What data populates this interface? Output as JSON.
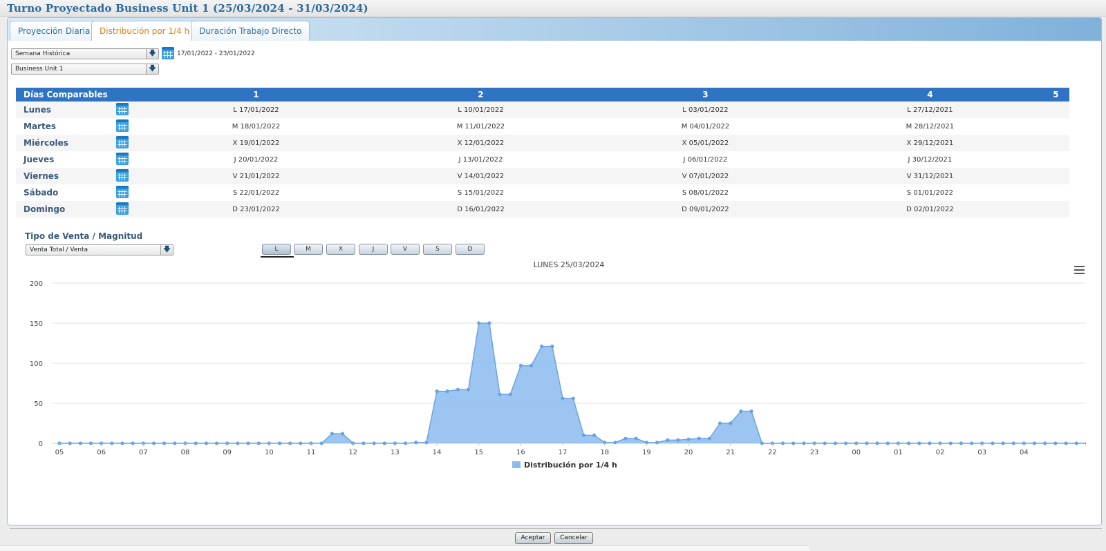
{
  "window": {
    "title": "Turno Proyectado Business Unit 1 (25/03/2024 - 31/03/2024)"
  },
  "tabs": [
    {
      "label": "Proyección Diaria",
      "active": false
    },
    {
      "label": "Distribución por 1/4 h",
      "active": true
    },
    {
      "label": "Duración Trabajo Directo",
      "active": false
    }
  ],
  "filters": {
    "week_select": "Semana Histórica",
    "week_range": "17/01/2022 - 23/01/2022",
    "unit_select": "Business Unit 1"
  },
  "comparable": {
    "header": "Días Comparables",
    "columns": [
      "1",
      "2",
      "3",
      "4",
      "5"
    ],
    "rows": [
      {
        "day": "Lunes",
        "dates": [
          "L 17/01/2022",
          "L 10/01/2022",
          "L 03/01/2022",
          "L 27/12/2021",
          ""
        ]
      },
      {
        "day": "Martes",
        "dates": [
          "M 18/01/2022",
          "M 11/01/2022",
          "M 04/01/2022",
          "M 28/12/2021",
          ""
        ]
      },
      {
        "day": "Miércoles",
        "dates": [
          "X 19/01/2022",
          "X 12/01/2022",
          "X 05/01/2022",
          "X 29/12/2021",
          ""
        ]
      },
      {
        "day": "Jueves",
        "dates": [
          "J 20/01/2022",
          "J 13/01/2022",
          "J 06/01/2022",
          "J 30/12/2021",
          ""
        ]
      },
      {
        "day": "Viernes",
        "dates": [
          "V 21/01/2022",
          "V 14/01/2022",
          "V 07/01/2022",
          "V 31/12/2021",
          ""
        ]
      },
      {
        "day": "Sábado",
        "dates": [
          "S 22/01/2022",
          "S 15/01/2022",
          "S 08/01/2022",
          "S 01/01/2022",
          ""
        ]
      },
      {
        "day": "Domingo",
        "dates": [
          "D 23/01/2022",
          "D 16/01/2022",
          "D 09/01/2022",
          "D 02/01/2022",
          ""
        ]
      }
    ]
  },
  "sales_type": {
    "label": "Tipo de Venta / Magnitud",
    "value": "Venta Total / Venta"
  },
  "day_buttons": [
    "L",
    "M",
    "X",
    "J",
    "V",
    "S",
    "D"
  ],
  "selected_day": "L",
  "actions": {
    "accept": "Aceptar",
    "cancel": "Cancelar"
  },
  "icons": {
    "calendar": "calendar-icon",
    "dropdown": "arrow-down-icon",
    "menu": "hamburger-menu-icon"
  },
  "colors": {
    "tab_active": "#e07b10",
    "table_header": "#2f74c2",
    "series_fill": "#8bbcee",
    "series_line": "#6aa3e0"
  },
  "chart_data": {
    "type": "area",
    "title": "LUNES 25/03/2024",
    "xlabel": "",
    "ylabel": "",
    "ylim": [
      0,
      200
    ],
    "yticks": [
      0,
      50,
      100,
      150,
      200
    ],
    "grid": true,
    "legend": "bottom-center",
    "x_tick_labels": [
      "05",
      "06",
      "07",
      "08",
      "09",
      "10",
      "11",
      "12",
      "13",
      "14",
      "15",
      "16",
      "17",
      "18",
      "19",
      "20",
      "21",
      "22",
      "23",
      "00",
      "01",
      "02",
      "03",
      "04"
    ],
    "series": [
      {
        "name": "Distribución por 1/4 h",
        "values": [
          0,
          0,
          0,
          0,
          0,
          0,
          0,
          0,
          0,
          0,
          0,
          0,
          0,
          0,
          0,
          0,
          0,
          0,
          0,
          0,
          0,
          0,
          0,
          0,
          0,
          0,
          12,
          12,
          0,
          0,
          0,
          0,
          0,
          0,
          1,
          1,
          65,
          65,
          67,
          67,
          150,
          150,
          61,
          61,
          97,
          97,
          121,
          121,
          56,
          56,
          10,
          10,
          1,
          1,
          6,
          6,
          1,
          1,
          4,
          4,
          5,
          6,
          6,
          25,
          25,
          40,
          40,
          0,
          0,
          0,
          0,
          0,
          0,
          0,
          0,
          0,
          0,
          0,
          0,
          0,
          0,
          0,
          0,
          0,
          0,
          0,
          0,
          0,
          0,
          0,
          0,
          0,
          0,
          0,
          0,
          0,
          0,
          0,
          0,
          0
        ]
      }
    ]
  }
}
